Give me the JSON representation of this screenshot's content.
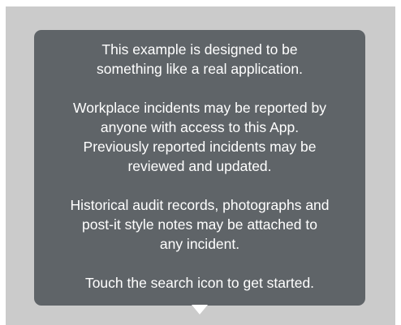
{
  "popover": {
    "paragraphs": [
      {
        "lines": [
          "This example is designed to be",
          "something like a real application."
        ]
      },
      {
        "lines": [
          "Workplace incidents may be reported by",
          "anyone with access to this App.",
          "Previously reported incidents may be",
          "reviewed and updated."
        ]
      },
      {
        "lines": [
          "Historical audit records, photographs and",
          "post-it style notes may be attached to",
          "any incident."
        ]
      },
      {
        "lines": [
          "Touch the search icon to get started."
        ]
      }
    ]
  },
  "colors": {
    "popover_background": "#5f6468",
    "backdrop": "#cbcbcb",
    "text": "#ffffff"
  }
}
